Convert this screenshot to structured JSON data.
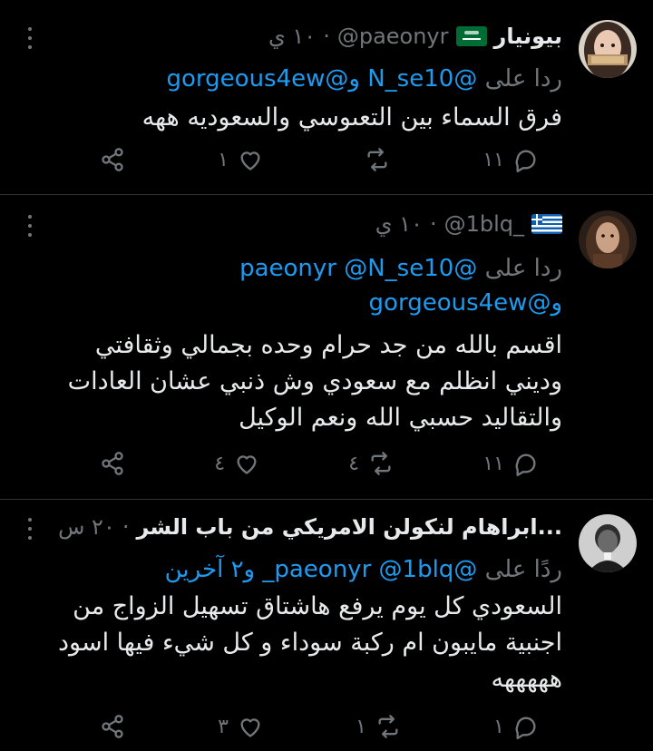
{
  "tweets": [
    {
      "name": "بيونيار",
      "handle": "@paeonyr",
      "time": "١٠ ي",
      "reply_prefix": "ردا على",
      "mentions": [
        "@N_se10",
        "و@gorgeous4ew"
      ],
      "text": [
        "فرق السماء بين التعىوسي والسعوديه ههه"
      ],
      "counts": {
        "replies": "١١",
        "retweets": "",
        "likes": "١",
        "share": ""
      },
      "flag": "saudi-arabia-flag"
    },
    {
      "name": "",
      "handle": "@1blq_",
      "time": "١٠ ي",
      "reply_prefix": "ردا على",
      "mentions": [
        "@paeonyr",
        "@N_se10",
        "و@gorgeous4ew"
      ],
      "text": [
        "اقسم بالله من جد حرام وحده بجمالي وثقافتي",
        "وديني انظلم مع سعودي وش ذنبي عشان العادات",
        "والتقاليد حسبي الله ونعم الوكيل"
      ],
      "counts": {
        "replies": "١١",
        "retweets": "٤",
        "likes": "٤",
        "share": ""
      },
      "flag": "greece-flag"
    },
    {
      "name": "ابراهام لنكولن الامريكي من باب الشر...",
      "handle": "",
      "time": "٢٠ س",
      "reply_prefix": "ردًا على",
      "mentions": [
        "@paeonyr",
        "@1blq_",
        "و٢ آخرين"
      ],
      "text": [
        "السعودي كل يوم يرفع هاشتاق تسهيل الزواج من",
        "اجنبية مايبون ام ركبة سوداء و كل شيء فيها اسود",
        "هههههه"
      ],
      "counts": {
        "replies": "١",
        "retweets": "١",
        "likes": "٣",
        "share": ""
      }
    }
  ],
  "colors": {
    "background": "#000000",
    "text": "#e7e9ea",
    "muted": "#71767b",
    "link": "#1d9bf0",
    "divider": "#2f3336"
  }
}
